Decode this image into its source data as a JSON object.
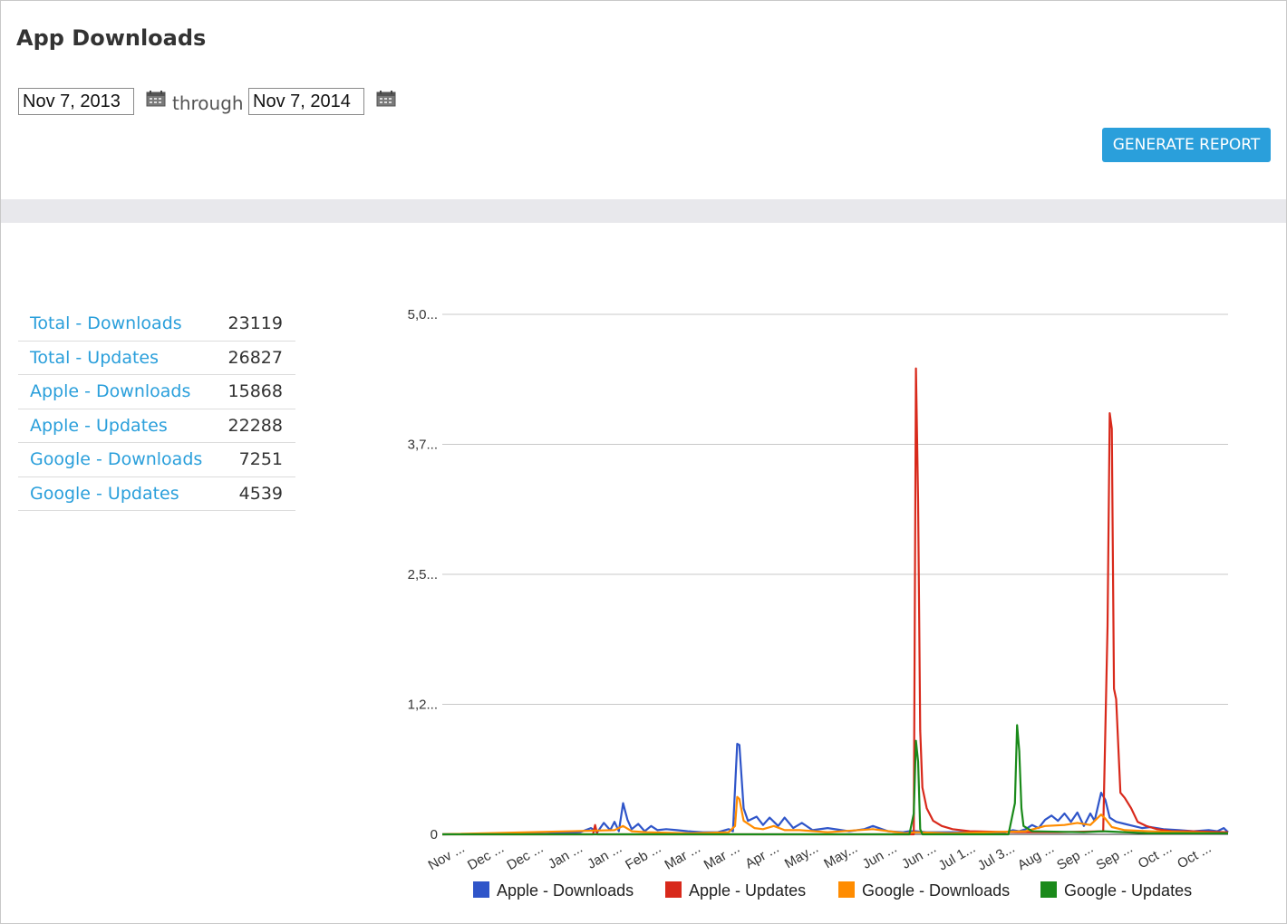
{
  "header": {
    "title": "App Downloads"
  },
  "date_range": {
    "from": "Nov 7, 2013",
    "through_label": "through",
    "to": "Nov 7, 2014"
  },
  "actions": {
    "generate_label": "GENERATE REPORT"
  },
  "colors": {
    "accent": "#2a9fdb",
    "apple_downloads": "#2f55c9",
    "apple_updates": "#d8291b",
    "google_downloads": "#ff8c00",
    "google_updates": "#1a8a1a"
  },
  "icons": {
    "calendar": "calendar-icon"
  },
  "stats": [
    {
      "label": "Total - Downloads",
      "value": "23119"
    },
    {
      "label": "Total - Updates",
      "value": "26827"
    },
    {
      "label": "Apple - Downloads",
      "value": "15868"
    },
    {
      "label": "Apple - Updates",
      "value": "22288"
    },
    {
      "label": "Google - Downloads",
      "value": "7251"
    },
    {
      "label": "Google - Updates",
      "value": "4539"
    }
  ],
  "chart_data": {
    "type": "line",
    "title": "",
    "xlabel": "",
    "ylabel": "",
    "ylim": [
      0,
      5000
    ],
    "grid": true,
    "legend_position": "bottom",
    "y_tick_labels": [
      "0",
      "1,2...",
      "2,5...",
      "3,7...",
      "5,0..."
    ],
    "y_tick_values": [
      0,
      1250,
      2500,
      3750,
      5000
    ],
    "x_tick_labels": [
      "Nov ...",
      "Dec ...",
      "Dec ...",
      "Jan ...",
      "Jan ...",
      "Feb ...",
      "Mar ...",
      "Mar ...",
      "Apr ...",
      "May...",
      "May...",
      "Jun ...",
      "Jun ...",
      "Jul 1...",
      "Jul 3...",
      "Aug ...",
      "Sep ...",
      "Sep ...",
      "Oct ...",
      "Oct ..."
    ],
    "x_range": [
      "2013-11-07",
      "2014-11-07"
    ],
    "series": [
      {
        "name": "Apple - Downloads",
        "color": "#2f55c9",
        "points": [
          [
            "2013-11-07",
            0
          ],
          [
            "2013-12-10",
            8
          ],
          [
            "2013-12-25",
            5
          ],
          [
            "2014-01-10",
            20
          ],
          [
            "2014-01-15",
            60
          ],
          [
            "2014-01-18",
            20
          ],
          [
            "2014-01-21",
            110
          ],
          [
            "2014-01-24",
            40
          ],
          [
            "2014-01-26",
            120
          ],
          [
            "2014-01-28",
            30
          ],
          [
            "2014-01-30",
            300
          ],
          [
            "2014-02-01",
            140
          ],
          [
            "2014-02-03",
            50
          ],
          [
            "2014-02-06",
            100
          ],
          [
            "2014-02-09",
            30
          ],
          [
            "2014-02-12",
            80
          ],
          [
            "2014-02-15",
            40
          ],
          [
            "2014-02-19",
            50
          ],
          [
            "2014-02-24",
            40
          ],
          [
            "2014-03-01",
            30
          ],
          [
            "2014-03-08",
            20
          ],
          [
            "2014-03-15",
            20
          ],
          [
            "2014-03-20",
            50
          ],
          [
            "2014-03-22",
            30
          ],
          [
            "2014-03-24",
            870
          ],
          [
            "2014-03-25",
            860
          ],
          [
            "2014-03-27",
            250
          ],
          [
            "2014-03-29",
            130
          ],
          [
            "2014-04-02",
            170
          ],
          [
            "2014-04-05",
            90
          ],
          [
            "2014-04-08",
            160
          ],
          [
            "2014-04-12",
            80
          ],
          [
            "2014-04-15",
            160
          ],
          [
            "2014-04-19",
            60
          ],
          [
            "2014-04-23",
            110
          ],
          [
            "2014-04-28",
            40
          ],
          [
            "2014-05-05",
            60
          ],
          [
            "2014-05-15",
            30
          ],
          [
            "2014-05-22",
            50
          ],
          [
            "2014-05-26",
            80
          ],
          [
            "2014-06-02",
            30
          ],
          [
            "2014-06-09",
            20
          ],
          [
            "2014-06-12",
            30
          ],
          [
            "2014-06-15",
            30
          ],
          [
            "2014-06-20",
            20
          ],
          [
            "2014-07-01",
            20
          ],
          [
            "2014-07-15",
            20
          ],
          [
            "2014-07-25",
            10
          ],
          [
            "2014-07-30",
            40
          ],
          [
            "2014-08-02",
            30
          ],
          [
            "2014-08-05",
            50
          ],
          [
            "2014-08-08",
            90
          ],
          [
            "2014-08-11",
            60
          ],
          [
            "2014-08-14",
            140
          ],
          [
            "2014-08-17",
            180
          ],
          [
            "2014-08-20",
            130
          ],
          [
            "2014-08-23",
            200
          ],
          [
            "2014-08-26",
            120
          ],
          [
            "2014-08-29",
            210
          ],
          [
            "2014-09-01",
            80
          ],
          [
            "2014-09-04",
            200
          ],
          [
            "2014-09-06",
            130
          ],
          [
            "2014-09-09",
            400
          ],
          [
            "2014-09-11",
            330
          ],
          [
            "2014-09-13",
            160
          ],
          [
            "2014-09-16",
            120
          ],
          [
            "2014-09-20",
            100
          ],
          [
            "2014-09-24",
            80
          ],
          [
            "2014-09-28",
            60
          ],
          [
            "2014-10-02",
            70
          ],
          [
            "2014-10-08",
            50
          ],
          [
            "2014-10-15",
            40
          ],
          [
            "2014-10-22",
            30
          ],
          [
            "2014-10-29",
            40
          ],
          [
            "2014-11-02",
            30
          ],
          [
            "2014-11-05",
            60
          ],
          [
            "2014-11-07",
            20
          ]
        ]
      },
      {
        "name": "Apple - Updates",
        "color": "#d8291b",
        "points": [
          [
            "2013-11-07",
            0
          ],
          [
            "2014-01-16",
            0
          ],
          [
            "2014-01-17",
            90
          ],
          [
            "2014-01-18",
            0
          ],
          [
            "2014-06-14",
            0
          ],
          [
            "2014-06-15",
            4480
          ],
          [
            "2014-06-16",
            3200
          ],
          [
            "2014-06-17",
            1000
          ],
          [
            "2014-06-18",
            450
          ],
          [
            "2014-06-20",
            250
          ],
          [
            "2014-06-23",
            130
          ],
          [
            "2014-06-27",
            80
          ],
          [
            "2014-07-02",
            50
          ],
          [
            "2014-07-10",
            30
          ],
          [
            "2014-08-01",
            20
          ],
          [
            "2014-08-20",
            20
          ],
          [
            "2014-09-10",
            30
          ],
          [
            "2014-09-12",
            2000
          ],
          [
            "2014-09-13",
            4050
          ],
          [
            "2014-09-14",
            3900
          ],
          [
            "2014-09-15",
            1400
          ],
          [
            "2014-09-16",
            1300
          ],
          [
            "2014-09-18",
            400
          ],
          [
            "2014-09-20",
            350
          ],
          [
            "2014-09-23",
            250
          ],
          [
            "2014-09-26",
            120
          ],
          [
            "2014-09-30",
            80
          ],
          [
            "2014-10-05",
            50
          ],
          [
            "2014-10-12",
            30
          ],
          [
            "2014-10-20",
            30
          ],
          [
            "2014-11-07",
            20
          ]
        ]
      },
      {
        "name": "Google - Downloads",
        "color": "#ff8c00",
        "points": [
          [
            "2013-11-07",
            0
          ],
          [
            "2014-01-26",
            40
          ],
          [
            "2014-01-30",
            80
          ],
          [
            "2014-02-03",
            30
          ],
          [
            "2014-02-10",
            20
          ],
          [
            "2014-03-01",
            10
          ],
          [
            "2014-03-20",
            20
          ],
          [
            "2014-03-23",
            80
          ],
          [
            "2014-03-24",
            360
          ],
          [
            "2014-03-25",
            340
          ],
          [
            "2014-03-27",
            130
          ],
          [
            "2014-04-01",
            60
          ],
          [
            "2014-04-05",
            50
          ],
          [
            "2014-04-10",
            80
          ],
          [
            "2014-04-15",
            40
          ],
          [
            "2014-04-22",
            40
          ],
          [
            "2014-05-05",
            20
          ],
          [
            "2014-05-26",
            50
          ],
          [
            "2014-06-10",
            10
          ],
          [
            "2014-06-15",
            20
          ],
          [
            "2014-07-01",
            10
          ],
          [
            "2014-08-05",
            30
          ],
          [
            "2014-08-14",
            80
          ],
          [
            "2014-08-23",
            90
          ],
          [
            "2014-08-29",
            110
          ],
          [
            "2014-09-04",
            90
          ],
          [
            "2014-09-09",
            190
          ],
          [
            "2014-09-11",
            150
          ],
          [
            "2014-09-14",
            70
          ],
          [
            "2014-09-20",
            40
          ],
          [
            "2014-10-01",
            30
          ],
          [
            "2014-10-20",
            20
          ],
          [
            "2014-11-07",
            10
          ]
        ]
      },
      {
        "name": "Google - Updates",
        "color": "#1a8a1a",
        "points": [
          [
            "2013-11-07",
            0
          ],
          [
            "2014-06-12",
            0
          ],
          [
            "2014-06-14",
            200
          ],
          [
            "2014-06-15",
            900
          ],
          [
            "2014-06-16",
            700
          ],
          [
            "2014-06-17",
            50
          ],
          [
            "2014-06-18",
            0
          ],
          [
            "2014-07-28",
            0
          ],
          [
            "2014-07-31",
            300
          ],
          [
            "2014-08-01",
            1050
          ],
          [
            "2014-08-02",
            800
          ],
          [
            "2014-08-03",
            250
          ],
          [
            "2014-08-04",
            80
          ],
          [
            "2014-08-08",
            30
          ],
          [
            "2014-09-01",
            20
          ],
          [
            "2014-09-10",
            30
          ],
          [
            "2014-10-01",
            10
          ],
          [
            "2014-11-07",
            10
          ]
        ]
      }
    ]
  }
}
